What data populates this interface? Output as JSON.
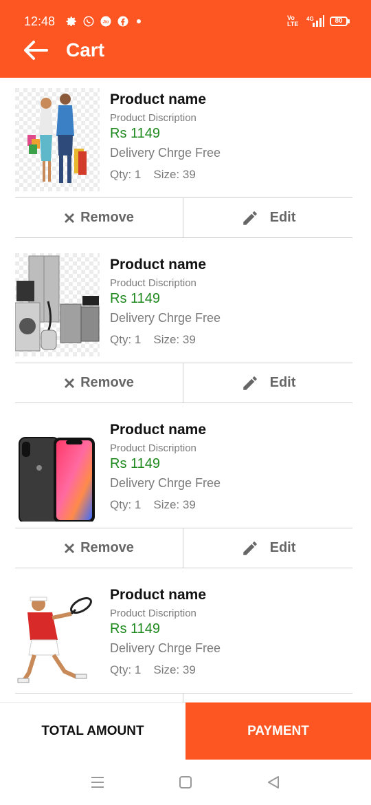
{
  "status_bar": {
    "time": "12:48",
    "network": "Vo LTE",
    "signal": "4G",
    "battery": "80"
  },
  "header": {
    "title": "Cart",
    "back_icon": "arrow-left-icon",
    "background": "#fe5622"
  },
  "products": [
    {
      "name": "Product name",
      "description": "Product Discription",
      "price": "Rs 1149",
      "delivery": "Delivery Chrge Free",
      "qty": "Qty: 1",
      "size": "Size: 39",
      "image": "couple-shopping-image"
    },
    {
      "name": "Product name",
      "description": "Product Discription",
      "price": "Rs 1149",
      "delivery": "Delivery Chrge Free",
      "qty": "Qty: 1",
      "size": "Size: 39",
      "image": "home-appliances-image"
    },
    {
      "name": "Product name",
      "description": "Product Discription",
      "price": "Rs 1149",
      "delivery": "Delivery Chrge Free",
      "qty": "Qty: 1",
      "size": "Size: 39",
      "image": "smartphone-image"
    },
    {
      "name": "Product name",
      "description": "Product Discription",
      "price": "Rs 1149",
      "delivery": "Delivery Chrge Free",
      "qty": "Qty: 1",
      "size": "Size: 39",
      "image": "tennis-player-image"
    }
  ],
  "actions": {
    "remove_label": "Remove",
    "edit_label": "Edit"
  },
  "footer": {
    "total_label": "TOTAL AMOUNT",
    "payment_label": "PAYMENT"
  },
  "colors": {
    "accent": "#fe5622",
    "price": "#1e8a1e",
    "muted": "#7a7a7a"
  }
}
